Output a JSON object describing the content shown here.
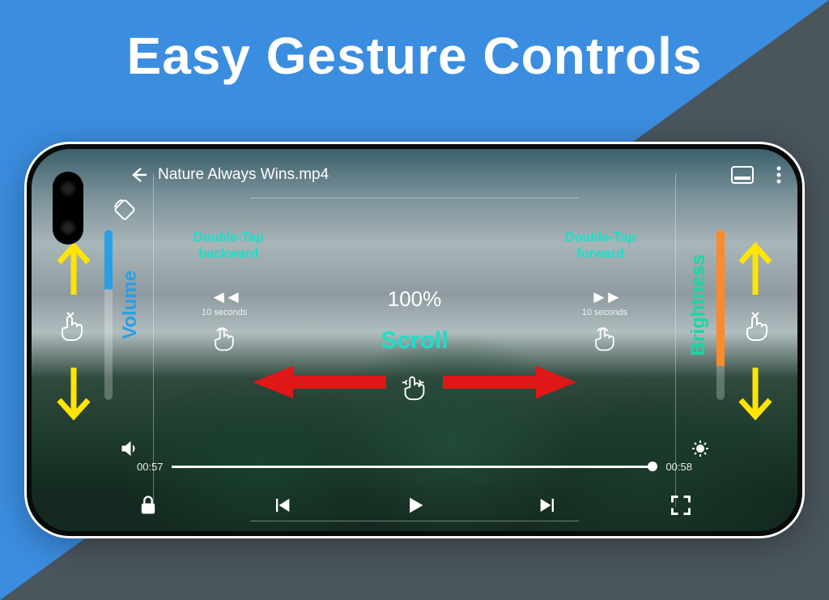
{
  "headline": "Easy Gesture Controls",
  "video": {
    "title": "Nature Always Wins.mp4",
    "current_time": "00:57",
    "duration": "00:58",
    "zoom": "100%"
  },
  "gestures": {
    "volume_label": "Volume",
    "brightness_label": "Brightness",
    "scroll_label": "Scroll",
    "double_tap_back": "Double-Tap\nbackward",
    "double_tap_fwd": "Double-Tap\nforward",
    "seek_amount": "10 seconds"
  }
}
